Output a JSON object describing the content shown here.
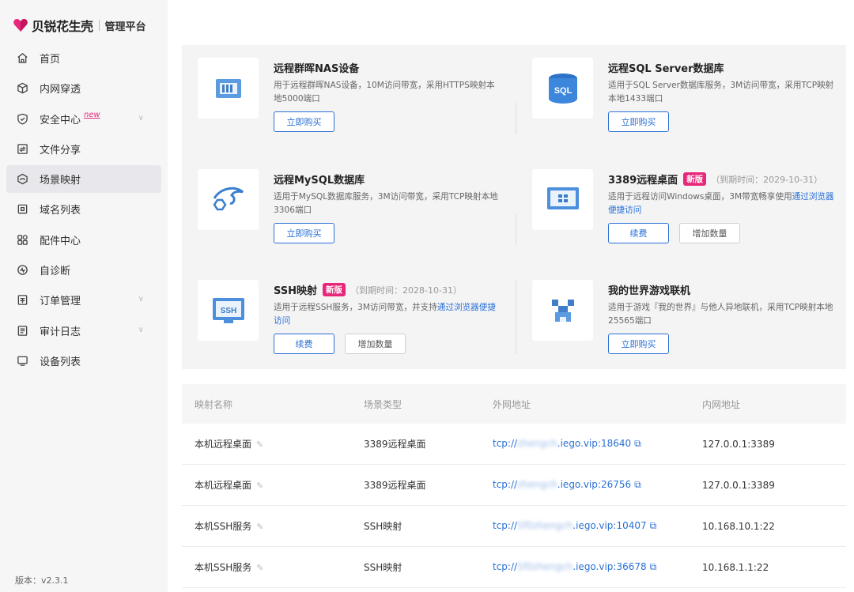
{
  "app": {
    "brand_name": "贝锐花生壳",
    "brand_sub": "管理平台",
    "version": "版本：v2.3.1",
    "accent": "#e8267a",
    "link_color": "#2a70d6"
  },
  "sidebar": {
    "items": [
      {
        "label": "首页",
        "icon": "home-icon"
      },
      {
        "label": "内网穿透",
        "icon": "cube-icon"
      },
      {
        "label": "安全中心",
        "icon": "shield-icon",
        "badge": "new",
        "has_submenu": true
      },
      {
        "label": "文件分享",
        "icon": "file-share-icon"
      },
      {
        "label": "场景映射",
        "icon": "scene-icon",
        "active": true
      },
      {
        "label": "域名列表",
        "icon": "domain-icon"
      },
      {
        "label": "配件中心",
        "icon": "grid-icon"
      },
      {
        "label": "自诊断",
        "icon": "diagnose-icon"
      },
      {
        "label": "订单管理",
        "icon": "order-icon",
        "has_submenu": true
      },
      {
        "label": "审计日志",
        "icon": "log-icon",
        "has_submenu": true
      },
      {
        "label": "设备列表",
        "icon": "monitor-icon"
      }
    ]
  },
  "cards": [
    {
      "title": "远程群晖NAS设备",
      "desc": "用于远程群晖NAS设备，10M访问带宽，采用HTTPS映射本地5000端口",
      "buttons": [
        "立即购买"
      ],
      "icon": "nas-icon"
    },
    {
      "title": "远程SQL Server数据库",
      "desc": "适用于SQL Server数据库服务，3M访问带宽，采用TCP映射本地1433端口",
      "buttons": [
        "立即购买"
      ],
      "icon": "sql-icon"
    },
    {
      "title": "远程MySQL数据库",
      "desc": "适用于MySQL数据库服务，3M访问带宽，采用TCP映射本地3306端口",
      "buttons": [
        "立即购买"
      ],
      "icon": "mysql-dolphin-icon"
    },
    {
      "title": "3389远程桌面",
      "badge": "新版",
      "expire": "（到期时间：2029-10-31）",
      "desc": "适用于远程访问Windows桌面，3M带宽畅享使用",
      "desc_link": "通过浏览器便捷访问",
      "buttons": [
        "续费",
        "增加数量"
      ],
      "icon": "windows-icon"
    },
    {
      "title": "SSH映射",
      "badge": "新版",
      "expire": "（到期时间：2028-10-31）",
      "desc": "适用于远程SSH服务，3M访问带宽，并支持",
      "desc_link": "通过浏览器便捷访问",
      "buttons": [
        "续费",
        "增加数量"
      ],
      "icon": "ssh-icon"
    },
    {
      "title": "我的世界游戏联机",
      "desc": "适用于游戏『我的世界』与他人异地联机，采用TCP映射本地25565端口",
      "buttons": [
        "立即购买"
      ],
      "icon": "minecraft-icon"
    }
  ],
  "table": {
    "headers": [
      "映射名称",
      "场景类型",
      "外网地址",
      "内网地址"
    ],
    "rows": [
      {
        "name": "本机远程桌面",
        "type": "3389远程桌面",
        "ext_prefix": "tcp://",
        "ext_blur": "zhengch",
        "ext_suffix": ".iego.vip:18640",
        "internal": "127.0.0.1:3389"
      },
      {
        "name": "本机远程桌面",
        "type": "3389远程桌面",
        "ext_prefix": "tcp://",
        "ext_blur": "zhengch",
        "ext_suffix": ".iego.vip:26756",
        "internal": "127.0.0.1:3389"
      },
      {
        "name": "本机SSH服务",
        "type": "SSH映射",
        "ext_prefix": "tcp://",
        "ext_blur": "5f0zhengch",
        "ext_suffix": ".iego.vip:10407",
        "internal": "10.168.10.1:22"
      },
      {
        "name": "本机SSH服务",
        "type": "SSH映射",
        "ext_prefix": "tcp://",
        "ext_blur": "5f0zhengch",
        "ext_suffix": ".iego.vip:36678",
        "internal": "10.168.1.1:22"
      }
    ]
  }
}
